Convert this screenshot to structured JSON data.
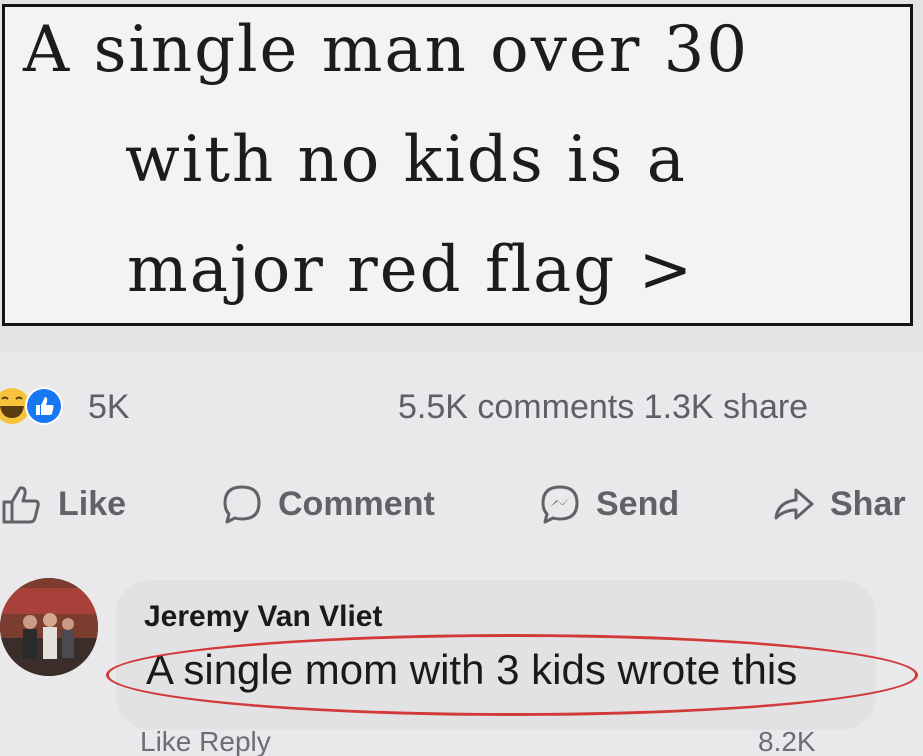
{
  "post": {
    "quote_lines": [
      "A single man over 30",
      "with no kids is a",
      "major red flag >"
    ]
  },
  "reactions": {
    "count": "5K",
    "stats": "5.5K comments 1.3K share"
  },
  "actions": {
    "like": "Like",
    "comment": "Comment",
    "send": "Send",
    "share": "Shar"
  },
  "comment": {
    "author": "Jeremy Van Vliet",
    "text": "A single mom with 3 kids wrote this",
    "footer_left": "Like   Reply",
    "footer_right": "8.2K"
  },
  "colors": {
    "like_blue": "#1877f2",
    "haha_yellow": "#f7c23c",
    "highlight_red": "#d23a3a"
  }
}
